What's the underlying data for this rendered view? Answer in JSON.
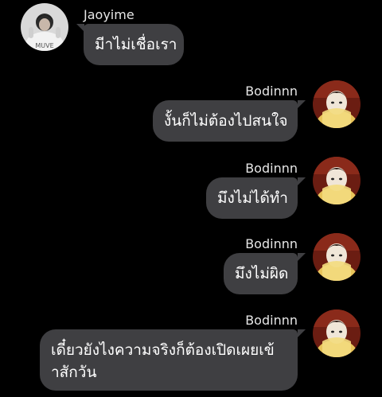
{
  "messages": [
    {
      "sender": "Jaoyime",
      "side": "left",
      "avatar": "avatar-photo-jaoyime",
      "text": "มีาไม่เชื่อเรา"
    },
    {
      "sender": "Bodinnn",
      "side": "right",
      "avatar": "avatar-photo-bodinnn",
      "text": "งั้นก็ไม่ต้องไปสนใจ"
    },
    {
      "sender": "Bodinnn",
      "side": "right",
      "avatar": "avatar-photo-bodinnn",
      "text": "มึงไม่ได้ทำ"
    },
    {
      "sender": "Bodinnn",
      "side": "right",
      "avatar": "avatar-photo-bodinnn",
      "text": "มึงไม่ผิด"
    },
    {
      "sender": "Bodinnn",
      "side": "right",
      "avatar": "avatar-photo-bodinnn",
      "text_line1": "เดี๋ยวยังไงความจริงก็ต้องเปิดเผยเข้",
      "text_line2": "าสักวัน"
    }
  ],
  "colors": {
    "background": "#000000",
    "bubble": "#3f3f42",
    "text": "#ffffff",
    "name": "#e6e6e6"
  }
}
